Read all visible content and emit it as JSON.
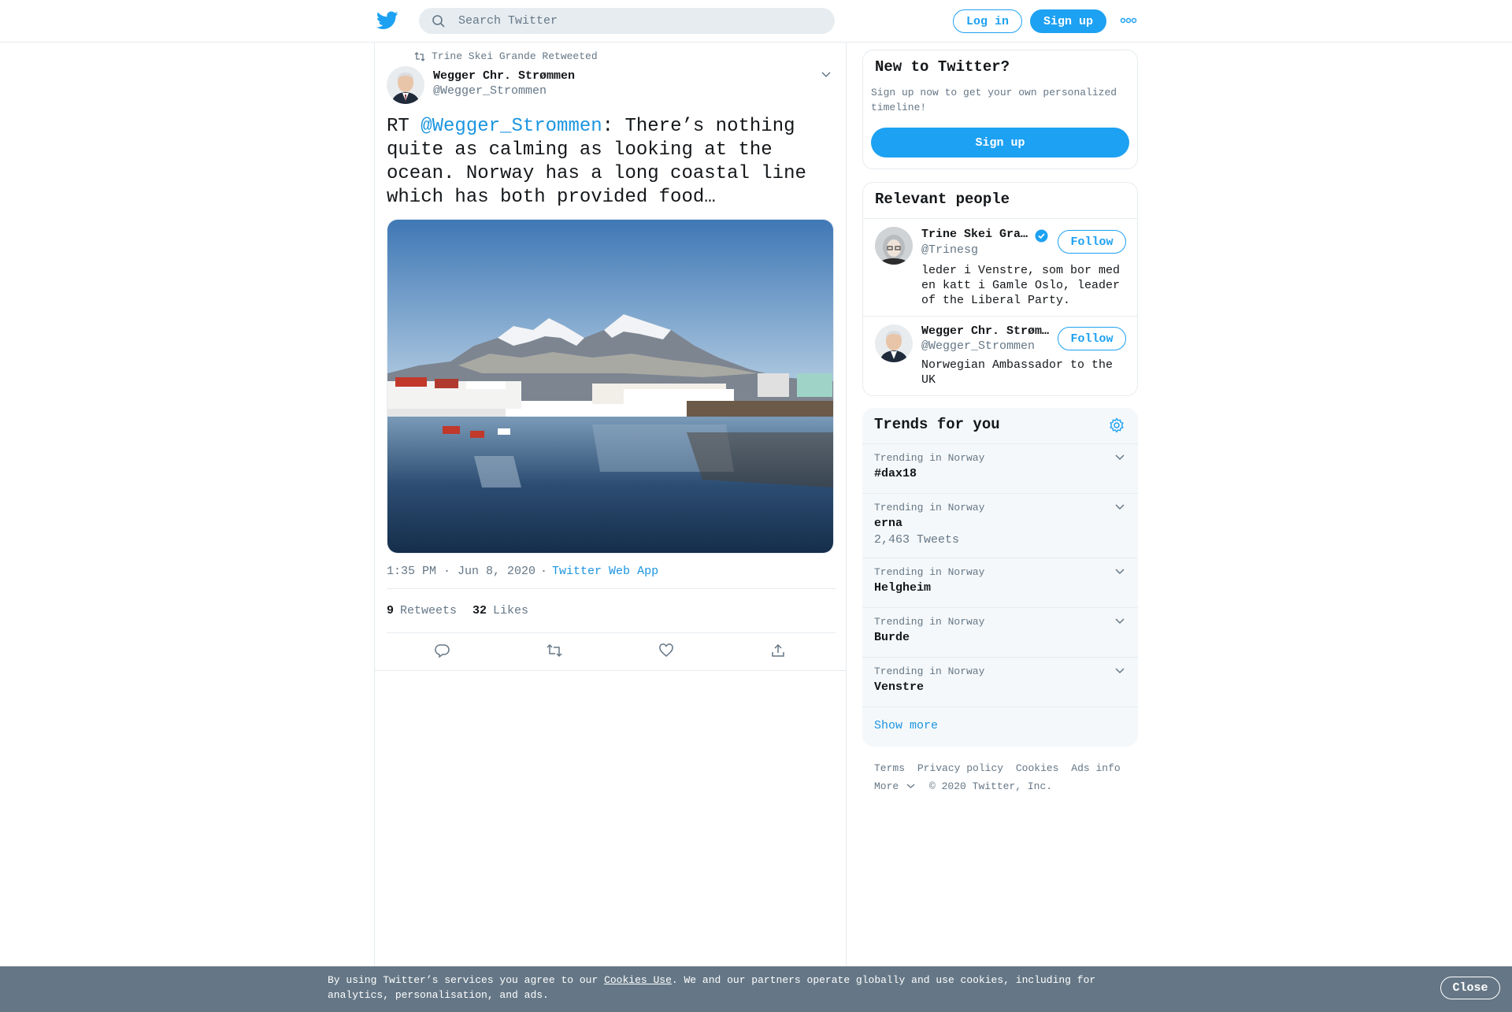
{
  "header": {
    "search_placeholder": "Search Twitter",
    "login_label": "Log in",
    "signup_label": "Sign up",
    "brand_color": "#1da1f2"
  },
  "tweet": {
    "retweeted_by": "Trine Skei Grande Retweeted",
    "author_name": "Wegger Chr. Strømmen",
    "author_handle": "@Wegger_Strommen",
    "text_prefix": "RT ",
    "text_mention": "@Wegger_Strommen",
    "text_body": ": There’s nothing quite as calming as looking at the ocean. Norway has a long coastal line which has both provided food…",
    "time": "1:35 PM · Jun 8, 2020",
    "separator": "·",
    "source": "Twitter Web App",
    "retweets_count": "9",
    "retweets_label": "Retweets",
    "likes_count": "32",
    "likes_label": "Likes",
    "icons": [
      "reply-icon",
      "retweet-icon",
      "like-icon",
      "share-icon"
    ]
  },
  "sidebar": {
    "new_title": "New to Twitter?",
    "new_desc": "Sign up now to get your own personalized timeline!",
    "signup_label": "Sign up",
    "people_title": "Relevant people",
    "people": [
      {
        "name": "Trine Skei Gra…",
        "handle": "@Trinesg",
        "bio": "leder i Venstre, som bor med en katt i Gamle Oslo, leader of the Liberal Party.",
        "follow_label": "Follow",
        "verified": true
      },
      {
        "name": "Wegger Chr. Strøm…",
        "handle": "@Wegger_Strommen",
        "bio": "Norwegian Ambassador to the UK",
        "follow_label": "Follow",
        "verified": false
      }
    ],
    "trends_title": "Trends for you",
    "trends": [
      {
        "context": "Trending in Norway",
        "name": "#dax18",
        "count": ""
      },
      {
        "context": "Trending in Norway",
        "name": "erna",
        "count": "2,463 Tweets"
      },
      {
        "context": "Trending in Norway",
        "name": "Helgheim",
        "count": ""
      },
      {
        "context": "Trending in Norway",
        "name": "Burde",
        "count": ""
      },
      {
        "context": "Trending in Norway",
        "name": "Venstre",
        "count": ""
      }
    ],
    "show_more": "Show more",
    "footer_links": [
      "Terms",
      "Privacy policy",
      "Cookies",
      "Ads info"
    ],
    "footer_more": "More",
    "copyright": "© 2020 Twitter, Inc."
  },
  "cookie_banner": {
    "text_before": "By using Twitter’s services you agree to our ",
    "link": "Cookies Use",
    "text_after": ". We and our partners operate globally and use cookies, including for analytics, personalisation, and ads.",
    "close_label": "Close"
  }
}
